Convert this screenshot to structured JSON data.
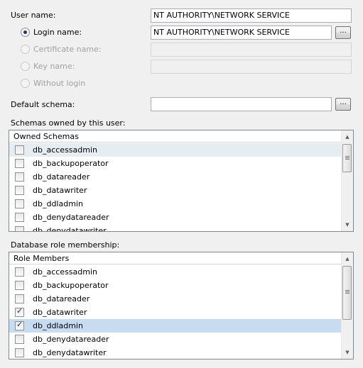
{
  "user_name": {
    "label": "User name:",
    "value": "NT AUTHORITY\\NETWORK SERVICE"
  },
  "login_options": [
    {
      "label": "Login name:",
      "checked": true,
      "enabled": true,
      "value": "NT AUTHORITY\\NETWORK SERVICE",
      "has_button": true
    },
    {
      "label": "Certificate name:",
      "checked": false,
      "enabled": false,
      "value": ""
    },
    {
      "label": "Key name:",
      "checked": false,
      "enabled": false,
      "value": ""
    },
    {
      "label": "Without login",
      "checked": false,
      "enabled": false
    }
  ],
  "browse_label": "...",
  "default_schema": {
    "label": "Default schema:",
    "value": ""
  },
  "schemas": {
    "label": "Schemas owned by this user:",
    "header": "Owned Schemas",
    "items": [
      {
        "name": "db_accessadmin",
        "checked": false,
        "state": "hover"
      },
      {
        "name": "db_backupoperator",
        "checked": false,
        "state": ""
      },
      {
        "name": "db_datareader",
        "checked": false,
        "state": ""
      },
      {
        "name": "db_datawriter",
        "checked": false,
        "state": ""
      },
      {
        "name": "db_ddladmin",
        "checked": false,
        "state": ""
      },
      {
        "name": "db_denydatareader",
        "checked": false,
        "state": ""
      },
      {
        "name": "db_denydatawriter",
        "checked": false,
        "state": ""
      }
    ]
  },
  "roles": {
    "label": "Database role membership:",
    "header": "Role Members",
    "items": [
      {
        "name": "db_accessadmin",
        "checked": false,
        "state": ""
      },
      {
        "name": "db_backupoperator",
        "checked": false,
        "state": ""
      },
      {
        "name": "db_datareader",
        "checked": false,
        "state": ""
      },
      {
        "name": "db_datawriter",
        "checked": true,
        "state": ""
      },
      {
        "name": "db_ddladmin",
        "checked": true,
        "state": "selected"
      },
      {
        "name": "db_denydatareader",
        "checked": false,
        "state": ""
      },
      {
        "name": "db_denydatawriter",
        "checked": false,
        "state": ""
      }
    ]
  },
  "icons": {
    "radio": "radio-button-icon",
    "checkbox": "checkbox-icon",
    "scroll_up": "scroll-up-arrow-icon",
    "scroll_down": "scroll-down-arrow-icon"
  },
  "colors": {
    "window_bg": "#f0f0f0",
    "selection": "#c7dcf1",
    "hover": "#e5ecf2",
    "disabled_text": "#a0a0a0"
  }
}
